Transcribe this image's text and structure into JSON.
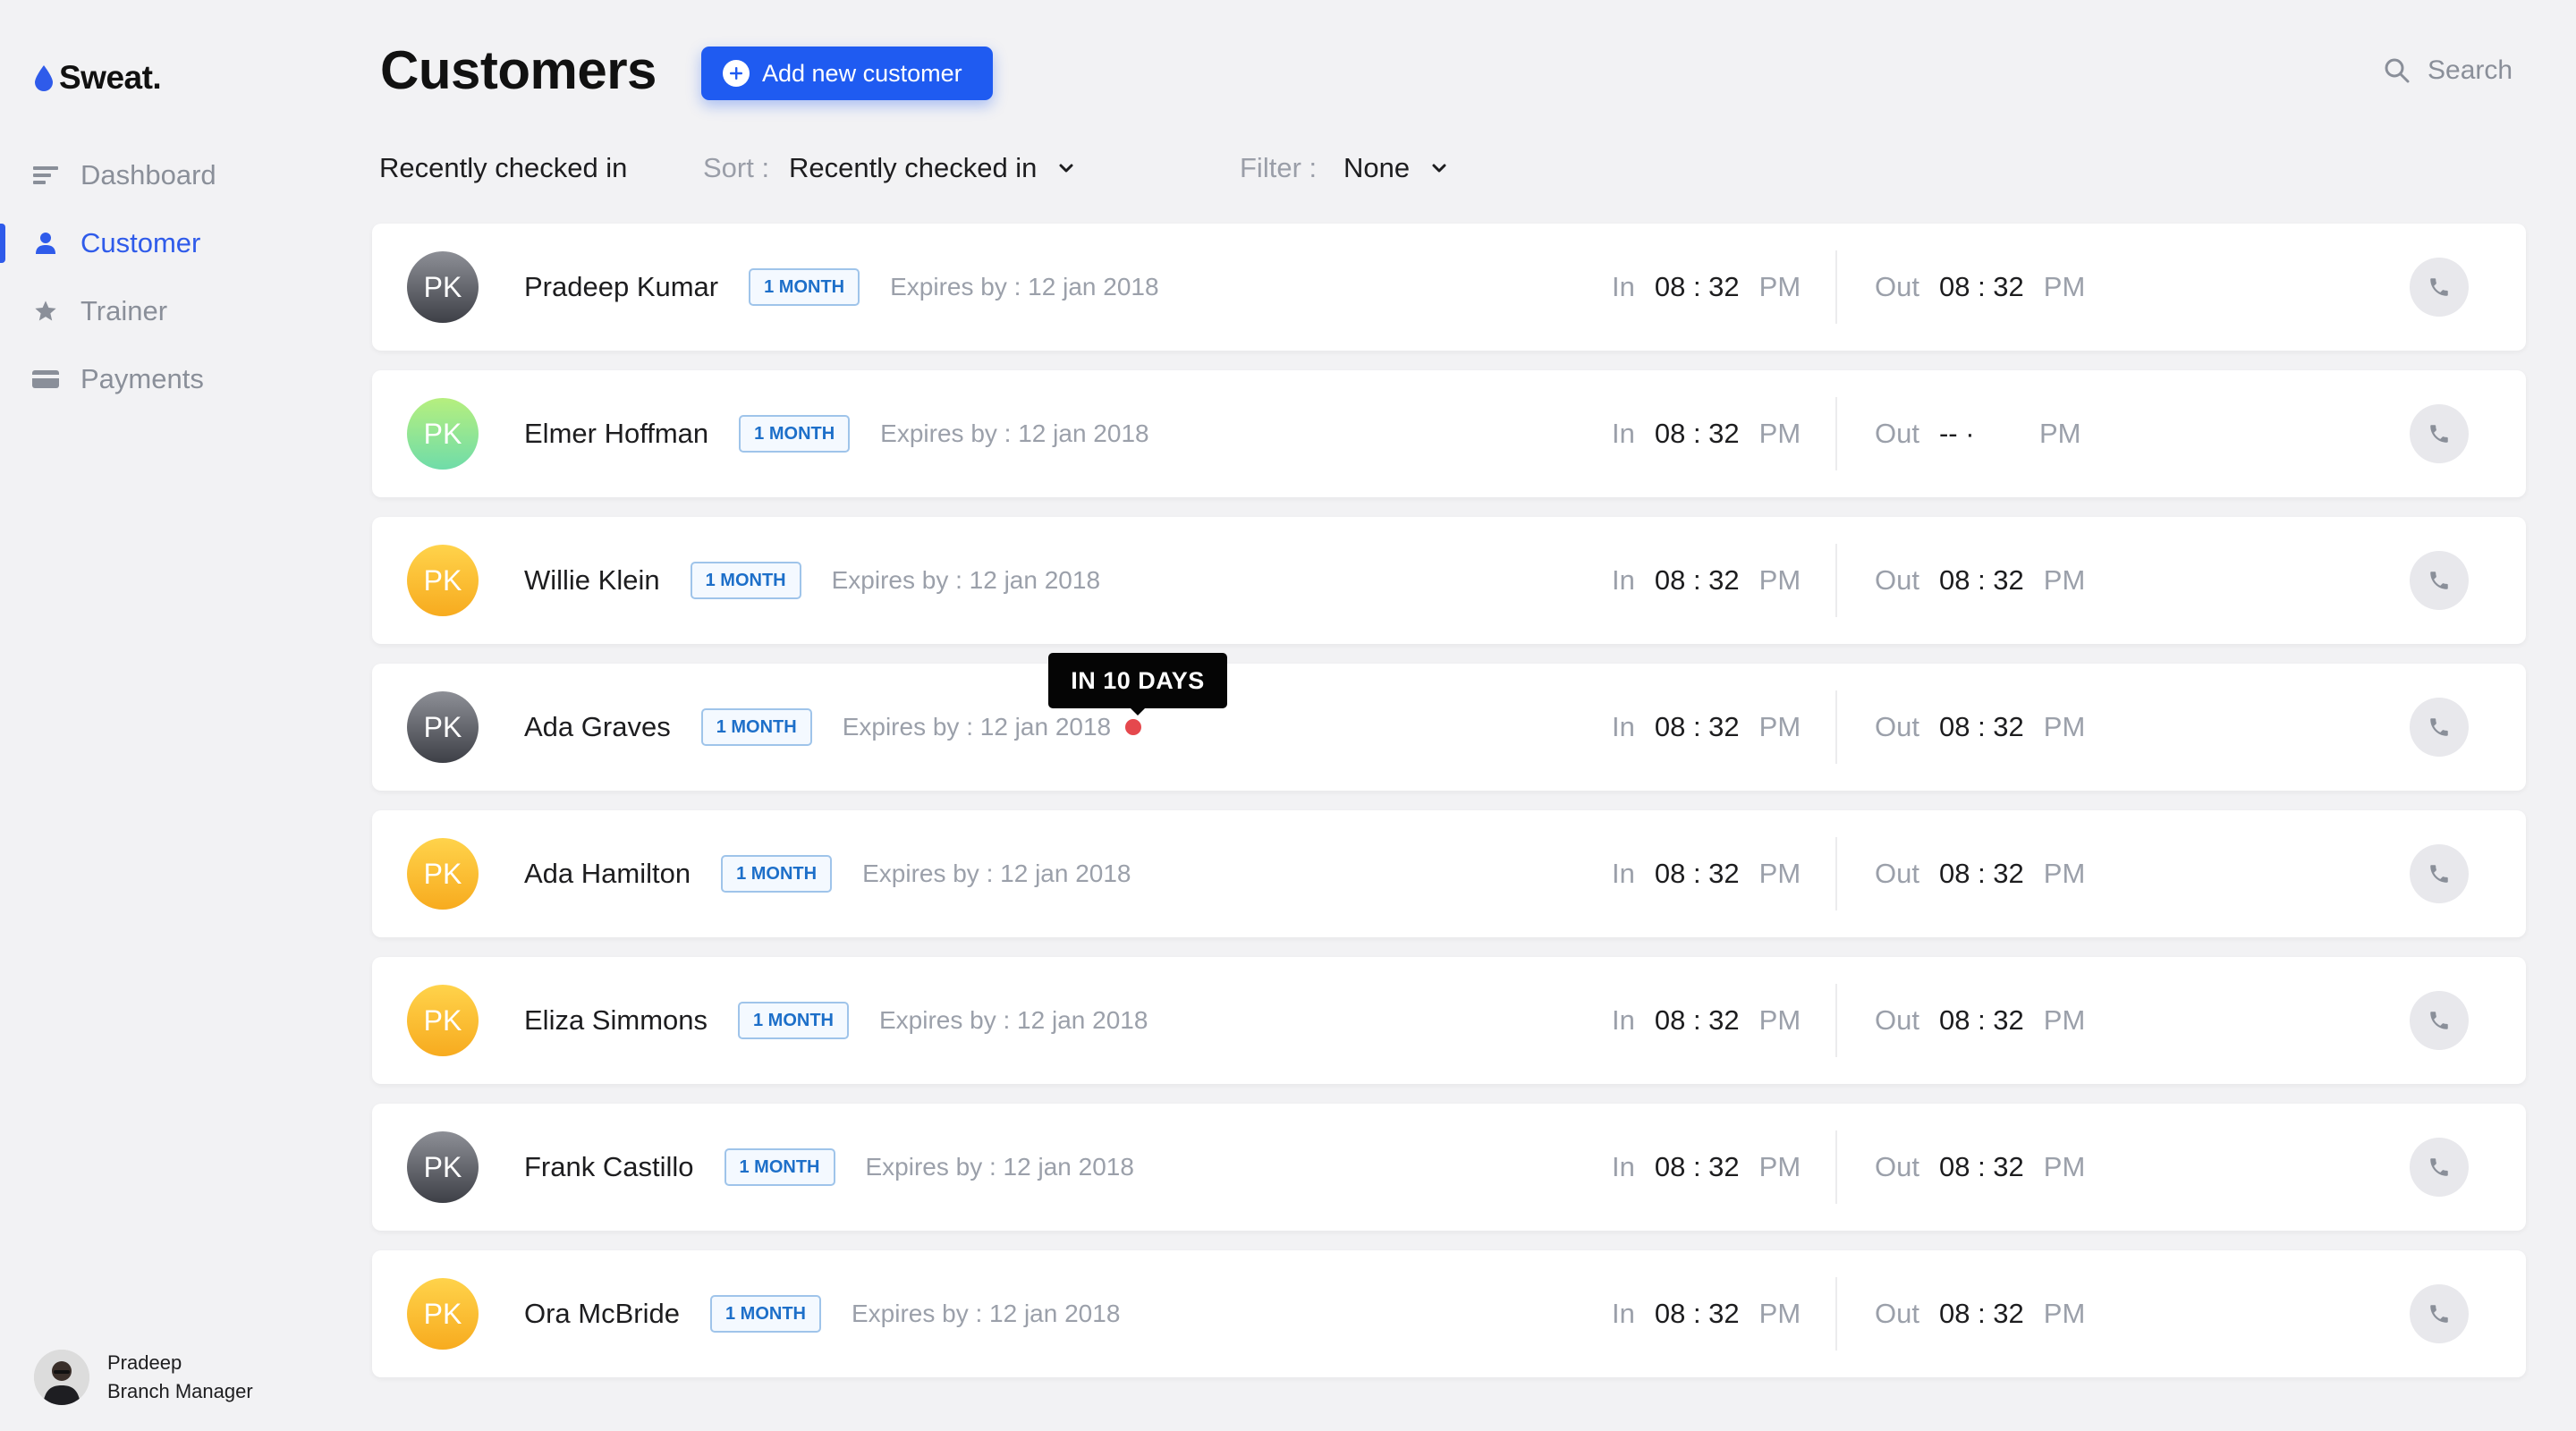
{
  "app": {
    "brand": "Sweat.",
    "accent": "#2f5bea"
  },
  "sidebar": {
    "items": [
      {
        "label": "Dashboard",
        "icon": "dashboard-icon",
        "active": false
      },
      {
        "label": "Customer",
        "icon": "user-icon",
        "active": true
      },
      {
        "label": "Trainer",
        "icon": "star-icon",
        "active": false
      },
      {
        "label": "Payments",
        "icon": "card-icon",
        "active": false
      }
    ],
    "user": {
      "name": "Pradeep",
      "role": "Branch Manager"
    }
  },
  "header": {
    "title": "Customers",
    "add_button": "Add new customer",
    "search_label": "Search"
  },
  "toolbar": {
    "view": "Recently checked in",
    "sort_label": "Sort :",
    "sort_value": "Recently checked in",
    "filter_label": "Filter :",
    "filter_value": "None"
  },
  "tooltip": {
    "text": "IN 10 DAYS"
  },
  "customers": [
    {
      "initials": "PK",
      "name": "Pradeep Kumar",
      "plan": "1 MONTH",
      "expires": "Expires by : 12 jan 2018",
      "in_label": "In",
      "in_time": "08 : 32",
      "in_ampm": "PM",
      "out_label": "Out",
      "out_time": "08 : 32",
      "out_ampm": "PM",
      "avatar_color": "gray"
    },
    {
      "initials": "PK",
      "name": "Elmer Hoffman",
      "plan": "1 MONTH",
      "expires": "Expires by : 12 jan 2018",
      "in_label": "In",
      "in_time": "08 : 32",
      "in_ampm": "PM",
      "out_label": "Out",
      "out_time": "-- ·",
      "out_ampm": "PM",
      "avatar_color": "green"
    },
    {
      "initials": "PK",
      "name": "Willie Klein",
      "plan": "1 MONTH",
      "expires": "Expires by : 12 jan 2018",
      "in_label": "In",
      "in_time": "08 : 32",
      "in_ampm": "PM",
      "out_label": "Out",
      "out_time": "08 : 32",
      "out_ampm": "PM",
      "avatar_color": "yellow"
    },
    {
      "initials": "PK",
      "name": "Ada Graves",
      "plan": "1 MONTH",
      "expires": "Expires by : 12 jan 2018",
      "in_label": "In",
      "in_time": "08 : 32",
      "in_ampm": "PM",
      "out_label": "Out",
      "out_time": "08 : 32",
      "out_ampm": "PM",
      "avatar_color": "gray"
    },
    {
      "initials": "PK",
      "name": "Ada Hamilton",
      "plan": "1 MONTH",
      "expires": "Expires by : 12 jan 2018",
      "in_label": "In",
      "in_time": "08 : 32",
      "in_ampm": "PM",
      "out_label": "Out",
      "out_time": "08 : 32",
      "out_ampm": "PM",
      "avatar_color": "yellow"
    },
    {
      "initials": "PK",
      "name": "Eliza Simmons",
      "plan": "1 MONTH",
      "expires": "Expires by : 12 jan 2018",
      "in_label": "In",
      "in_time": "08 : 32",
      "in_ampm": "PM",
      "out_label": "Out",
      "out_time": "08 : 32",
      "out_ampm": "PM",
      "avatar_color": "yellow"
    },
    {
      "initials": "PK",
      "name": "Frank Castillo",
      "plan": "1 MONTH",
      "expires": "Expires by : 12 jan 2018",
      "in_label": "In",
      "in_time": "08 : 32",
      "in_ampm": "PM",
      "out_label": "Out",
      "out_time": "08 : 32",
      "out_ampm": "PM",
      "avatar_color": "gray"
    },
    {
      "initials": "PK",
      "name": "Ora McBride",
      "plan": "1 MONTH",
      "expires": "Expires by : 12 jan 2018",
      "in_label": "In",
      "in_time": "08 : 32",
      "in_ampm": "PM",
      "out_label": "Out",
      "out_time": "08 : 32",
      "out_ampm": "PM",
      "avatar_color": "yellow"
    }
  ]
}
